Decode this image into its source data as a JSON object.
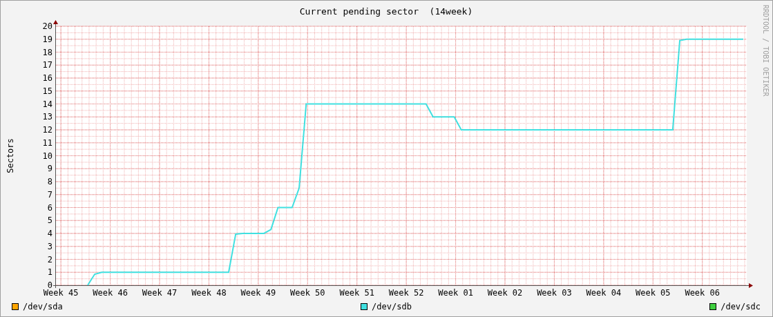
{
  "graph": {
    "side_text": "RRDTOOL / TOBI OETIKER",
    "chart_data": {
      "type": "line",
      "title": "Current pending sector  (14week)",
      "ylabel": "Sectors",
      "categories": [
        "Week 45",
        null,
        null,
        null,
        null,
        null,
        null,
        "Week 46",
        null,
        null,
        null,
        null,
        null,
        null,
        "Week 47",
        null,
        null,
        null,
        null,
        null,
        null,
        "Week 48",
        null,
        null,
        null,
        null,
        null,
        null,
        "Week 49",
        null,
        null,
        null,
        null,
        null,
        null,
        "Week 50",
        null,
        null,
        null,
        null,
        null,
        null,
        "Week 51",
        null,
        null,
        null,
        null,
        null,
        null,
        "Week 52",
        null,
        null,
        null,
        null,
        null,
        null,
        "Week 01",
        null,
        null,
        null,
        null,
        null,
        null,
        "Week 02",
        null,
        null,
        null,
        null,
        null,
        null,
        "Week 03",
        null,
        null,
        null,
        null,
        null,
        null,
        "Week 04",
        null,
        null,
        null,
        null,
        null,
        null,
        "Week 05",
        null,
        null,
        null,
        null,
        null,
        null,
        "Week 06",
        null,
        null,
        null,
        null,
        null,
        null
      ],
      "ylim": [
        0,
        20
      ],
      "grid": true,
      "yticks": [
        0,
        1,
        2,
        3,
        4,
        5,
        6,
        7,
        8,
        9,
        10,
        11,
        12,
        13,
        14,
        15,
        16,
        17,
        18,
        19,
        20
      ],
      "series": [
        {
          "name": "/dev/sda",
          "color": "#ffa500",
          "values": [
            null,
            null,
            null,
            null,
            null,
            null,
            null,
            null,
            null,
            null,
            null,
            null,
            null,
            null,
            null,
            null,
            null,
            null,
            null,
            null,
            null,
            null,
            null,
            null,
            null,
            null,
            null,
            null,
            null,
            null,
            null,
            null,
            null,
            null,
            null,
            null,
            null,
            null,
            null,
            null,
            null,
            null,
            null,
            null,
            null,
            null,
            null,
            null,
            null,
            null,
            null,
            null,
            null,
            null,
            null,
            null,
            null,
            null,
            null,
            null,
            null,
            null,
            null,
            null,
            null,
            null,
            null,
            null,
            null,
            null,
            null,
            null,
            null,
            null,
            null,
            null,
            null,
            null,
            null,
            null,
            null,
            null,
            null,
            null,
            null,
            null,
            null,
            null,
            null,
            null,
            null,
            null,
            null,
            null,
            null,
            null,
            null,
            null
          ]
        },
        {
          "name": "/dev/sdb",
          "color": "#40e0e0",
          "values": [
            null,
            null,
            null,
            null,
            0,
            0.85,
            1,
            1,
            1,
            1,
            1,
            1,
            1,
            1,
            1,
            1,
            1,
            1,
            1,
            1,
            1,
            1,
            1,
            1,
            1,
            3.95,
            4,
            4,
            4,
            4,
            4.3,
            6,
            6,
            6,
            7.5,
            14,
            14,
            14,
            14,
            14,
            14,
            14,
            14,
            14,
            14,
            14,
            14,
            14,
            14,
            14,
            14,
            14,
            14,
            13,
            13,
            13,
            13,
            12,
            12,
            12,
            12,
            12,
            12,
            12,
            12,
            12,
            12,
            12,
            12,
            12,
            12,
            12,
            12,
            12,
            12,
            12,
            12,
            12,
            12,
            12,
            12,
            12,
            12,
            12,
            12,
            12,
            12,
            12,
            18.9,
            19,
            19,
            19,
            19,
            19,
            19,
            19,
            19,
            19
          ]
        },
        {
          "name": "/dev/sdc",
          "color": "#40d040",
          "values": [
            null,
            null,
            null,
            null,
            null,
            null,
            null,
            null,
            null,
            null,
            null,
            null,
            null,
            null,
            null,
            null,
            null,
            null,
            null,
            null,
            null,
            null,
            null,
            null,
            null,
            null,
            null,
            null,
            null,
            null,
            null,
            null,
            null,
            null,
            null,
            null,
            null,
            null,
            null,
            null,
            null,
            null,
            null,
            null,
            null,
            null,
            null,
            null,
            null,
            null,
            null,
            null,
            null,
            null,
            null,
            null,
            null,
            null,
            null,
            null,
            null,
            null,
            null,
            null,
            null,
            null,
            null,
            null,
            null,
            null,
            null,
            null,
            null,
            null,
            null,
            null,
            null,
            null,
            null,
            null,
            null,
            null,
            null,
            null,
            null,
            null,
            null,
            null,
            null,
            null,
            null,
            null,
            null,
            null,
            null,
            null,
            null,
            null
          ]
        }
      ]
    }
  }
}
